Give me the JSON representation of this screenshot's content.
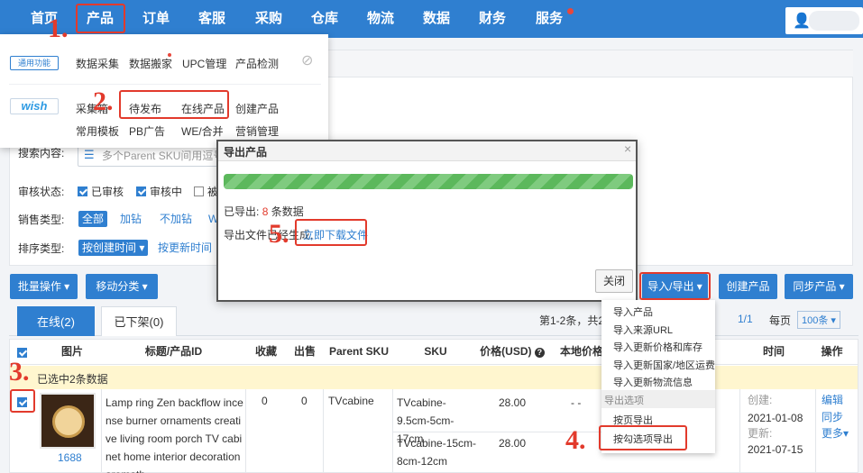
{
  "nav": {
    "items": [
      {
        "label": "首页"
      },
      {
        "label": "产品"
      },
      {
        "label": "订单"
      },
      {
        "label": "客服"
      },
      {
        "label": "采购"
      },
      {
        "label": "仓库"
      },
      {
        "label": "物流"
      },
      {
        "label": "数据"
      },
      {
        "label": "财务"
      },
      {
        "label": "服务"
      }
    ],
    "user_icon": "user-icon"
  },
  "dropdown": {
    "general_badge": "通用功能",
    "general_items": [
      "数据采集",
      "数据搬家",
      "UPC管理",
      "产品检测"
    ],
    "hide_icon": "eye-off-icon",
    "wish_badge": "wish",
    "wish_row1": [
      "采集箱",
      "待发布",
      "在线产品",
      "创建产品"
    ],
    "wish_row2": [
      "常用模板",
      "PB广告",
      "WE/合并",
      "营销管理"
    ]
  },
  "filters": {
    "search_label": "搜索内容:",
    "search_placeholder": "多个Parent SKU间用逗号隔",
    "audit_label": "审核状态:",
    "audit_options": [
      "已审核",
      "审核中",
      "被"
    ],
    "sale_label": "销售类型:",
    "sale_options": [
      "全部",
      "加钻",
      "不加钻",
      "W"
    ],
    "sort_label": "排序类型:",
    "sort_options": [
      "按创建时间 ▾",
      "按更新时间"
    ]
  },
  "toolbar": {
    "batch": "批量操作 ▾",
    "move": "移动分类 ▾",
    "import_export": "导入/导出 ▾",
    "create": "创建产品",
    "sync": "同步产品 ▾"
  },
  "tabs": [
    {
      "label": "在线(2)"
    },
    {
      "label": "已下架(0)"
    }
  ],
  "pagination": {
    "summary": "第1-2条，共2",
    "page": "1/1",
    "per_page_label": "每页",
    "per_page_value": "100条 ▾"
  },
  "table": {
    "headers": [
      "图片",
      "标题/产品ID",
      "收藏",
      "出售",
      "Parent SKU",
      "SKU",
      "价格(USD)",
      "本地价格",
      "时间",
      "操作"
    ],
    "selected_info": "已选中2条数据",
    "row": {
      "source": "1688",
      "title": "Lamp ring Zen backflow incense burner ornaments creative living room porch TV cabinet home interior decoration aromath",
      "favorites": "0",
      "sold": "0",
      "parent_sku": "TVcabine",
      "sku1": "TVcabine-9.5cm-5cm-17cm",
      "sku2": "TVcabine-15cm-8cm-12cm",
      "price1": "28.00",
      "price2": "28.00",
      "local_price": "- -",
      "created_label": "创建:",
      "created": "2021-01-08",
      "updated_label": "更新:",
      "updated": "2021-07-15",
      "actions": [
        "编辑",
        "同步",
        "更多▾"
      ]
    }
  },
  "modal": {
    "title": "导出产品",
    "close_x": "×",
    "progress_percent": 100,
    "exported_prefix": "已导出:",
    "exported_count": "8",
    "exported_suffix": "条数据",
    "file_text": "导出文件已经生成,",
    "download_link": "立即下载文件",
    "close_button": "关闭"
  },
  "import_export_menu": {
    "items": [
      "导入产品",
      "导入来源URL",
      "导入更新价格和库存",
      "导入更新国家/地区运费",
      "导入更新物流信息"
    ],
    "export_group": "导出选项",
    "export_items": [
      "按页导出",
      "按勾选项导出"
    ]
  },
  "annotations": [
    "1.",
    "2.",
    "3.",
    "4.",
    "5."
  ],
  "colors": {
    "primary": "#2f7fd0",
    "annotation": "#e23a2c",
    "progress": "#5cb85c",
    "selected_row": "#fff6cf"
  }
}
